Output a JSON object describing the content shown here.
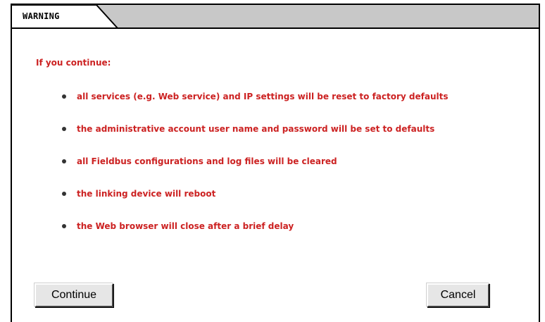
{
  "tab": {
    "label": "WARNING"
  },
  "content": {
    "intro": "If you continue:",
    "items": [
      "all services (e.g. Web service) and IP settings will be reset to factory defaults",
      "the administrative account user name and password will be set to defaults",
      "all Fieldbus configurations and log files will be cleared",
      "the linking device will reboot",
      "the Web browser will close after a brief delay"
    ]
  },
  "buttons": {
    "continue_label": "Continue",
    "cancel_label": "Cancel"
  },
  "colors": {
    "warning_text": "#cc2222",
    "tab_strip": "#c8c8c8",
    "button_face": "#e6e6e6"
  }
}
